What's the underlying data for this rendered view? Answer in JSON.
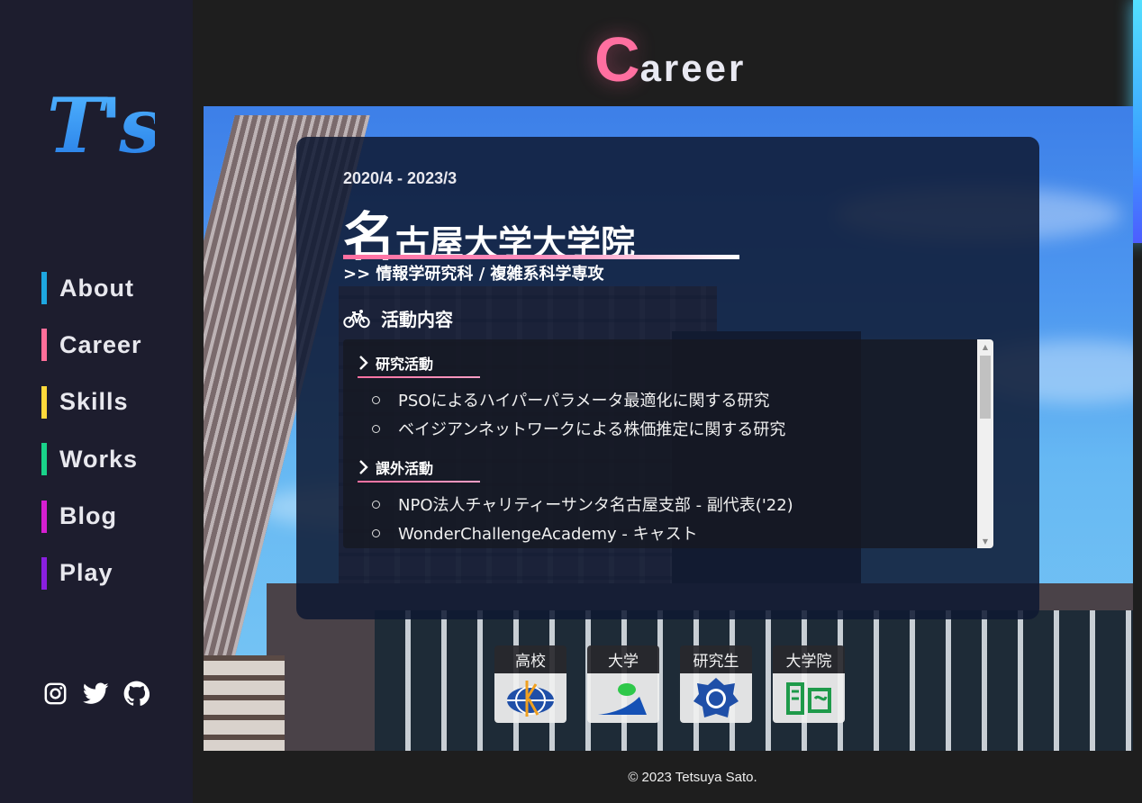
{
  "brand": {
    "logo_text": "T's"
  },
  "nav": {
    "items": [
      {
        "label": "About",
        "color": "#1ea7e0"
      },
      {
        "label": "Career",
        "color": "#ff6f9a"
      },
      {
        "label": "Skills",
        "color": "#ffd93b"
      },
      {
        "label": "Works",
        "color": "#19d38a"
      },
      {
        "label": "Blog",
        "color": "#d61fd1"
      },
      {
        "label": "Play",
        "color": "#8a1fe0"
      }
    ]
  },
  "social": [
    {
      "icon": "instagram-icon"
    },
    {
      "icon": "twitter-icon"
    },
    {
      "icon": "github-icon"
    }
  ],
  "header": {
    "title_first": "C",
    "title_rest": "areer"
  },
  "career": {
    "period": "2020/4 - 2023/3",
    "school_first": "名",
    "school_rest": "古屋大学大学院",
    "department": ">> 情報学研究科 / 複雑系科学専攻",
    "activity_heading": "活動内容",
    "sections": [
      {
        "title": "研究活動",
        "items": [
          "PSOによるハイパーパラメータ最適化に関する研究",
          "ベイジアンネットワークによる株価推定に関する研究"
        ]
      },
      {
        "title": "課外活動",
        "items": [
          "NPO法人チャリティーサンタ名古屋支部 - 副代表('22)",
          "WonderChallengeAcademy - キャスト"
        ]
      }
    ]
  },
  "badges": [
    {
      "label": "高校",
      "icon": "high-school-emblem-icon"
    },
    {
      "label": "大学",
      "icon": "university-emblem-icon"
    },
    {
      "label": "研究生",
      "icon": "research-student-emblem-icon"
    },
    {
      "label": "大学院",
      "icon": "graduate-school-emblem-icon"
    }
  ],
  "footer": {
    "copyright": "© 2023 Tetsuya Sato."
  },
  "colors": {
    "accent_pink": "#ff6fa0",
    "accent_cyan": "#53e0ff",
    "sidebar_bg": "#1d1d2e"
  }
}
